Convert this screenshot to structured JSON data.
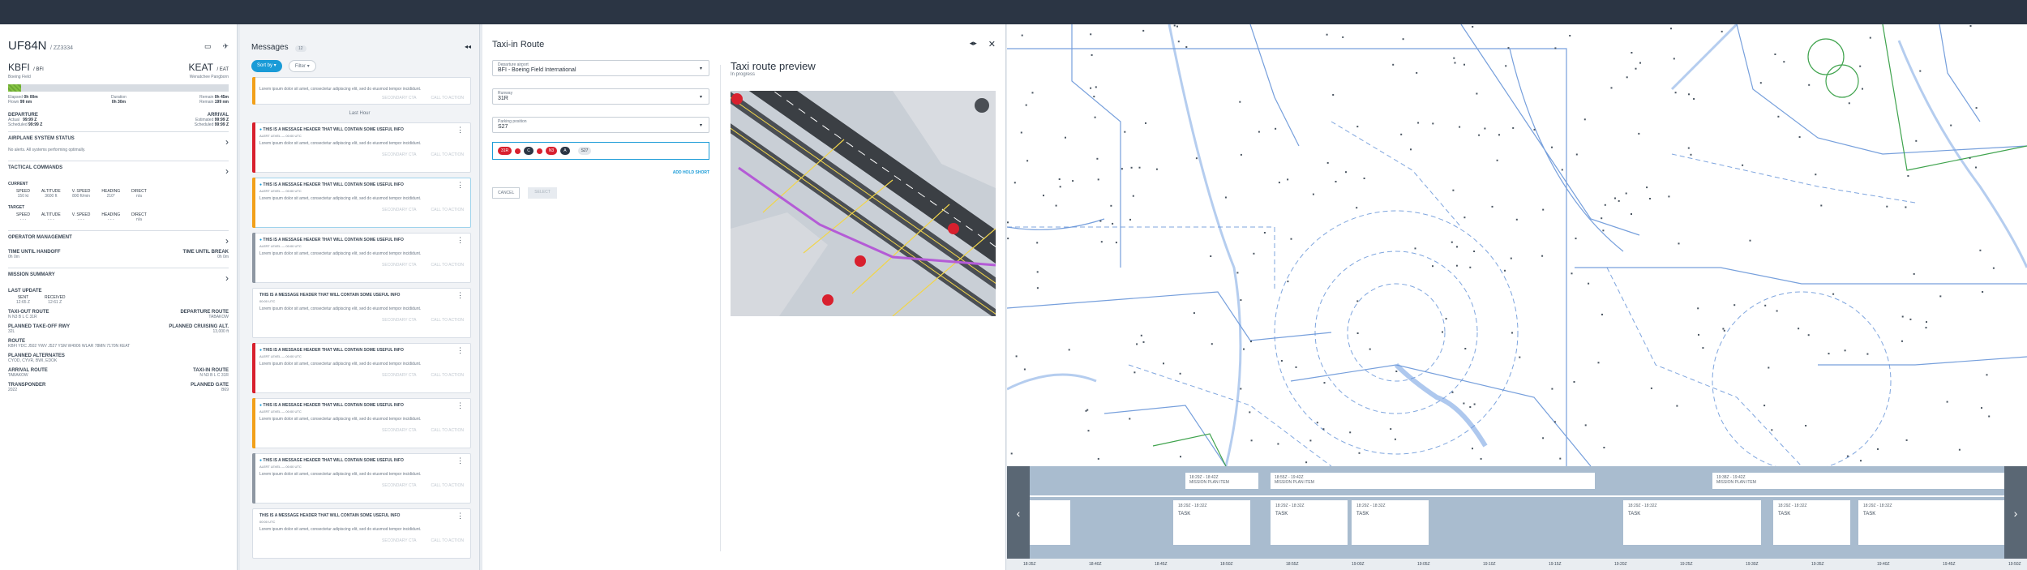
{
  "flight": {
    "callsign": "UF84N",
    "tail": "/ ZZ3334",
    "origin_code": "KBFI",
    "origin_iata": "/ BFI",
    "origin_name": "Boeing Field",
    "dest_code": "KEAT",
    "dest_iata": "/ EAT",
    "dest_name": "Wenatchee Pangborn",
    "elapsed_label": "Elapsed",
    "elapsed_val": "0h 00m",
    "flown_label": "Flown",
    "flown_val": "99 nm",
    "duration_label": "Duration",
    "duration_val": "0h 30m",
    "remain_label": "Remain",
    "remain_time": "0h 45m",
    "remain_nm": "199 nm",
    "progress": 0.06,
    "departure_label": "DEPARTURE",
    "arrival_label": "ARRIVAL",
    "actual_label": "Actual",
    "actual_val": "99:99 Z",
    "scheduled_label": "Scheduled",
    "scheduled_val": "99:99 Z",
    "estimated_label": "Estimated",
    "estimated_val": "99:99 Z",
    "arr_scheduled_label": "Scheduled",
    "arr_scheduled_val": "99:99 Z",
    "ass_title": "AIRPLANE SYSTEM STATUS",
    "ass_text": "No alerts. All systems performing optimally.",
    "tc_title": "TACTICAL COMMANDS",
    "current_label": "CURRENT",
    "target_label": "TARGET",
    "cmd_labels": [
      "SPEED",
      "ALTITUDE",
      "V. SPEED",
      "HEADING",
      "DIRECT"
    ],
    "cmd_current": [
      "150 kt",
      "3600 ft",
      "800 ft/min",
      "210°",
      "n/a"
    ],
    "cmd_target": [
      "- - -",
      "- - -",
      "- - -",
      "- - -",
      "n/a"
    ],
    "om_title": "OPERATOR MANAGEMENT",
    "handoff_label": "TIME UNTIL HANDOFF",
    "handoff_val": "0h 0m",
    "break_label": "TIME UNTIL BREAK",
    "break_val": "0h 0m",
    "ms_title": "MISSION SUMMARY",
    "last_update_label": "LAST UPDATE",
    "sent_label": "SENT",
    "sent_val": "12:65 Z",
    "received_label": "RECEIVED",
    "received_val": "12:61 Z",
    "taxi_out_label": "TAXI-OUT ROUTE",
    "taxi_out_val": "N N3 B L C 31R",
    "dep_route_label": "DEPARTURE ROUTE",
    "dep_route_val": "TABAKOW",
    "pto_label": "PLANNED TAKE-OFF RWY",
    "pto_val": "32L",
    "pca_label": "PLANNED CRUISING ALT.",
    "pca_val": "13,000 ft",
    "route_label": "ROUTE",
    "route_val": "KBFI YDC J502 YWV J527 YSM W4906 WLAR 78MN 7170N KEAT",
    "alt_label": "PLANNED ALTERNATES",
    "alt_val": "CYOD, CYVR, BWI, EDOK",
    "arr_route_label": "ARRIVAL ROUTE",
    "arr_route_val": "TABAKOW",
    "taxi_in_label": "TAXI-IN ROUTE",
    "taxi_in_val": "N N3 B L C 31R",
    "xpdr_label": "TRANSPONDER",
    "xpdr_val": "2022",
    "gate_label": "PLANNED GATE",
    "gate_val": "B69"
  },
  "messages": {
    "title": "Messages",
    "count": "12",
    "sort_label": "Sort by",
    "filter_label": "Filter",
    "top_snippet": "Lorem ipsum dolor sit amet, consectetur adipiscing elit, sed do eiusmod tempor incididunt.",
    "last_hour": "Last Hour",
    "secondary_cta": "SECONDARY CTA",
    "call_to_action": "CALL TO ACTION",
    "items": [
      {
        "header": "THIS IS A MESSAGE HEADER THAT WILL CONTAIN SOME USEFUL INFO",
        "meta": "ALERT LEVEL — 00:00 UTC",
        "body": "Lorem ipsum dolor sit amet, consectetur adipiscing elit, sed do eiusmod tempor incididunt.",
        "color": "#d8202e"
      },
      {
        "header": "THIS IS A MESSAGE HEADER THAT WILL CONTAIN SOME USEFUL INFO",
        "meta": "ALERT LEVEL — 00:00 UTC",
        "body": "Lorem ipsum dolor sit amet, consectetur adipiscing elit, sed do eiusmod tempor incididunt.",
        "color": "#f2a01a"
      },
      {
        "header": "THIS IS A MESSAGE HEADER THAT WILL CONTAIN SOME USEFUL INFO",
        "meta": "ALERT LEVEL — 00:00 UTC",
        "body": "Lorem ipsum dolor sit amet, consectetur adipiscing elit, sed do eiusmod tempor incididunt.",
        "color": "#8e97a2"
      },
      {
        "header": "THIS IS A MESSAGE HEADER THAT WILL CONTAIN SOME USEFUL INFO",
        "meta": "00:00 UTC",
        "body": "Lorem ipsum dolor sit amet, consectetur adipiscing elit, sed do eiusmod tempor incididunt.",
        "color": ""
      },
      {
        "header": "THIS IS A MESSAGE HEADER THAT WILL CONTAIN SOME USEFUL INFO",
        "meta": "ALERT LEVEL — 00:00 UTC",
        "body": "Lorem ipsum dolor sit amet, consectetur adipiscing elit, sed do eiusmod tempor incididunt.",
        "color": "#d8202e"
      },
      {
        "header": "THIS IS A MESSAGE HEADER THAT WILL CONTAIN SOME USEFUL INFO",
        "meta": "ALERT LEVEL — 00:00 UTC",
        "body": "Lorem ipsum dolor sit amet, consectetur adipiscing elit, sed do eiusmod tempor incididunt.",
        "color": "#f2a01a"
      },
      {
        "header": "THIS IS A MESSAGE HEADER THAT WILL CONTAIN SOME USEFUL INFO",
        "meta": "ALERT LEVEL — 00:00 UTC",
        "body": "Lorem ipsum dolor sit amet, consectetur adipiscing elit, sed do eiusmod tempor incididunt.",
        "color": "#8e97a2"
      },
      {
        "header": "THIS IS A MESSAGE HEADER THAT WILL CONTAIN SOME USEFUL INFO",
        "meta": "00:00 UTC",
        "body": "Lorem ipsum dolor sit amet, consectetur adipiscing elit, sed do eiusmod tempor incididunt.",
        "color": ""
      }
    ]
  },
  "taxi": {
    "title": "Taxi-in Route",
    "dep_airport_label": "Departure airport",
    "dep_airport_val": "BFI - Boeing Field International",
    "runway_label": "Runway",
    "runway_val": "31R",
    "parking_label": "Parking position",
    "parking_val": "S27",
    "route_chips": [
      "31R",
      "C",
      "N3",
      "A",
      "S27"
    ],
    "add_hold_short": "ADD HOLD SHORT",
    "cancel": "CANCEL",
    "select": "SELECT",
    "preview_title": "Taxi route preview",
    "preview_status": "In progress"
  },
  "timeline": {
    "times": [
      "18:35Z",
      "18:40Z",
      "18:45Z",
      "18:50Z",
      "18:55Z",
      "19:00Z",
      "19:05Z",
      "19:10Z",
      "19:15Z",
      "19:20Z",
      "19:25Z",
      "19:30Z",
      "19:35Z",
      "19:40Z",
      "19:45Z",
      "19:50Z"
    ],
    "mission_plan": [
      {
        "time": "18:29Z - 18:42Z",
        "label": "MISSION PLAN ITEM"
      },
      {
        "time": "18:55Z - 19:42Z",
        "label": "MISSION PLAN ITEM"
      },
      {
        "time": "19:38Z - 19:42Z",
        "label": "MISSION PLAN ITEM"
      }
    ],
    "tasks": [
      {
        "time": "18:29Z - 18:32Z",
        "label": "TASK"
      },
      {
        "time": "18:29Z - 18:32Z",
        "label": "TASK"
      },
      {
        "time": "18:29Z - 18:32Z",
        "label": "TASK"
      },
      {
        "time": "18:29Z - 18:32Z",
        "label": "TASK"
      },
      {
        "time": "18:29Z - 18:32Z",
        "label": "TASK"
      },
      {
        "time": "18:29Z - 18:32Z",
        "label": "TASK"
      }
    ]
  },
  "colors": {
    "accent": "#1a9bd7",
    "topbar": "#2b3544",
    "red": "#d8202e",
    "amber": "#f2a01a",
    "progress": "#84c341"
  }
}
